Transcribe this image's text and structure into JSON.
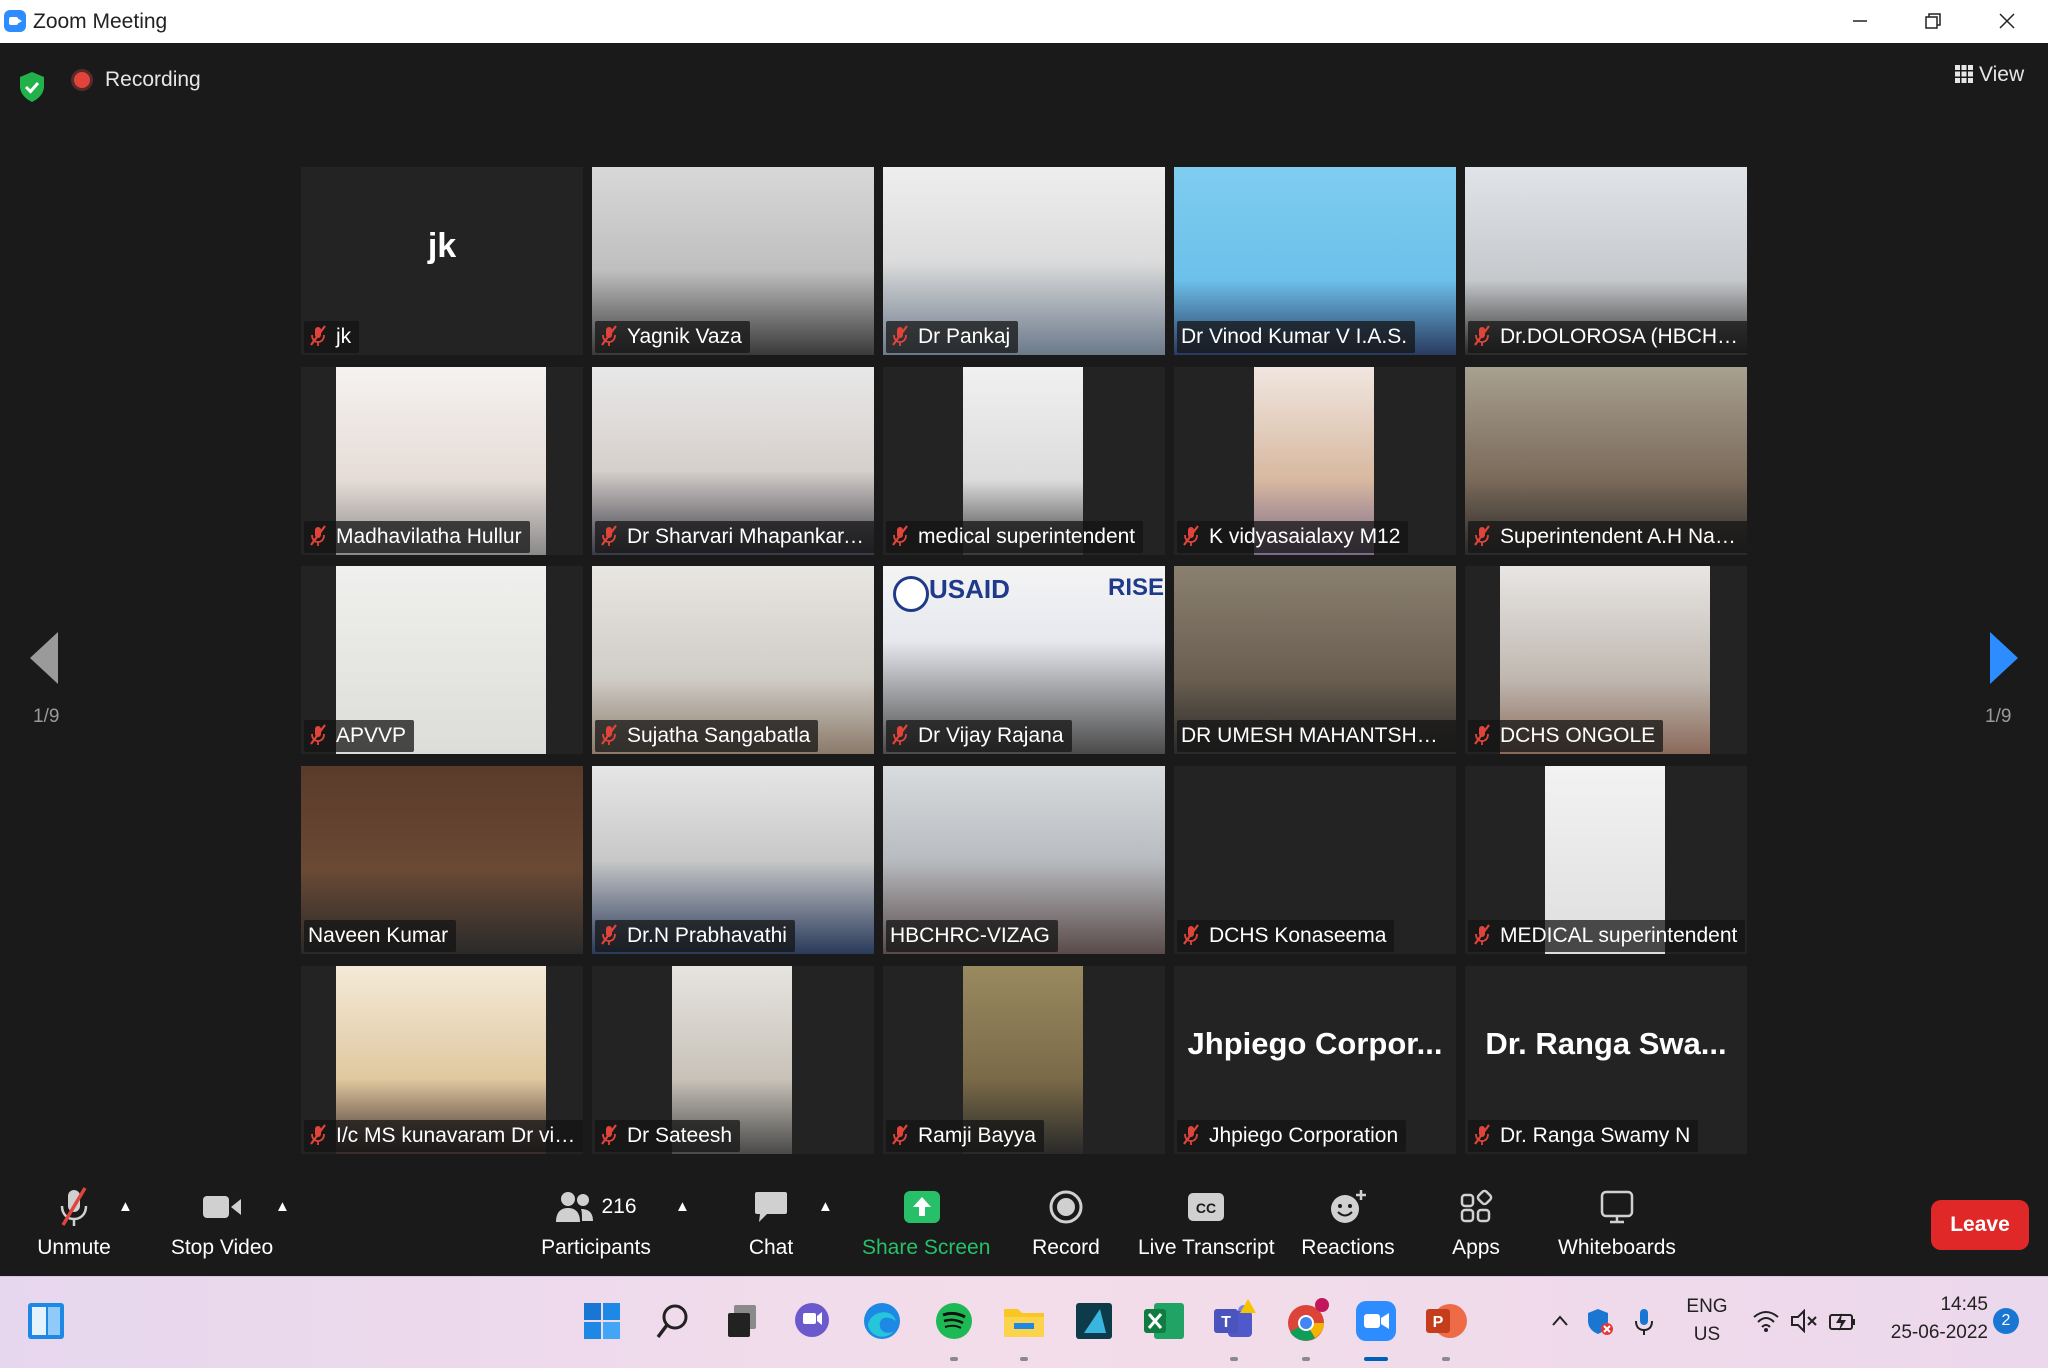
{
  "window": {
    "title": "Zoom Meeting",
    "minimize_icon": "minimize-icon",
    "restore_icon": "restore-icon",
    "close_icon": "close-icon"
  },
  "meeting": {
    "security_icon": "shield-check-icon",
    "recording_label": "Recording",
    "view_label": "View",
    "page_indicator": "1/9"
  },
  "participants": [
    {
      "name": "jk",
      "avatar_text": "jk",
      "muted": true,
      "active": false
    },
    {
      "name": "Yagnik Vaza",
      "muted": true,
      "active": false
    },
    {
      "name": "Dr Pankaj",
      "muted": true,
      "active": false
    },
    {
      "name": "Dr Vinod Kumar V  I.A.S.",
      "muted": false,
      "active": true
    },
    {
      "name": "Dr.DOLOROSA (HBCHRC-...",
      "muted": true,
      "active": false
    },
    {
      "name": "Madhavilatha Hullur",
      "muted": true,
      "active": false
    },
    {
      "name": "Dr Sharvari Mhapankar, ...",
      "muted": true,
      "active": false
    },
    {
      "name": "medical superintendent",
      "muted": true,
      "active": false
    },
    {
      "name": "K vidyasaialaxy M12",
      "muted": true,
      "active": false
    },
    {
      "name": "Superintendent A.H Nara...",
      "muted": true,
      "active": false
    },
    {
      "name": "APVVP",
      "muted": true,
      "active": false
    },
    {
      "name": "Sujatha Sangabatla",
      "muted": true,
      "active": false
    },
    {
      "name": "Dr Vijay Rajana",
      "muted": true,
      "active": false,
      "overlay_left": "USAID",
      "overlay_right": "RISE"
    },
    {
      "name": "DR UMESH MAHANTSHETTY",
      "muted": false,
      "active": false
    },
    {
      "name": "DCHS  ONGOLE",
      "muted": true,
      "active": false
    },
    {
      "name": "Naveen Kumar",
      "muted": false,
      "active": false
    },
    {
      "name": "Dr.N Prabhavathi",
      "muted": true,
      "active": false
    },
    {
      "name": "HBCHRC-VIZAG",
      "muted": false,
      "active": false
    },
    {
      "name": "DCHS Konaseema",
      "muted": true,
      "active": false
    },
    {
      "name": "MEDICAL superintendent",
      "muted": true,
      "active": false
    },
    {
      "name": "I/c MS kunavaram Dr vin...",
      "muted": true,
      "active": false
    },
    {
      "name": "Dr Sateesh",
      "muted": true,
      "active": false
    },
    {
      "name": "Ramji Bayya",
      "muted": true,
      "active": false
    },
    {
      "name": "Jhpiego Corporation",
      "avatar_text": "Jhpiego  Corpor...",
      "muted": true,
      "active": false
    },
    {
      "name": "Dr. Ranga Swamy N",
      "avatar_text": "Dr. Ranga Swa...",
      "muted": true,
      "active": false
    }
  ],
  "toolbar": {
    "unmute": "Unmute",
    "stop_video": "Stop Video",
    "participants": "Participants",
    "participant_count": "216",
    "chat": "Chat",
    "share_screen": "Share Screen",
    "record": "Record",
    "live_transcript": "Live Transcript",
    "cc_text": "CC",
    "reactions": "Reactions",
    "apps": "Apps",
    "whiteboards": "Whiteboards",
    "leave": "Leave"
  },
  "taskbar": {
    "apps": [
      "widgets-icon",
      "start-icon",
      "search-icon",
      "task-view-icon",
      "chat-icon",
      "edge-icon",
      "spotify-icon",
      "file-explorer-icon",
      "app-a-icon",
      "excel-icon",
      "teams-icon",
      "chrome-icon",
      "zoom-icon",
      "powerpoint-icon"
    ],
    "lang_line1": "ENG",
    "lang_line2": "US",
    "time": "14:45",
    "date": "25-06-2022",
    "notification_count": "2"
  },
  "colors": {
    "background": "#1a1a1a",
    "tile": "#232323",
    "active_speaker": "#d6ea62",
    "share_green": "#27c069",
    "leave_red": "#e02828",
    "zoom_blue": "#2D8CFF",
    "mute_red": "#e0443a"
  }
}
